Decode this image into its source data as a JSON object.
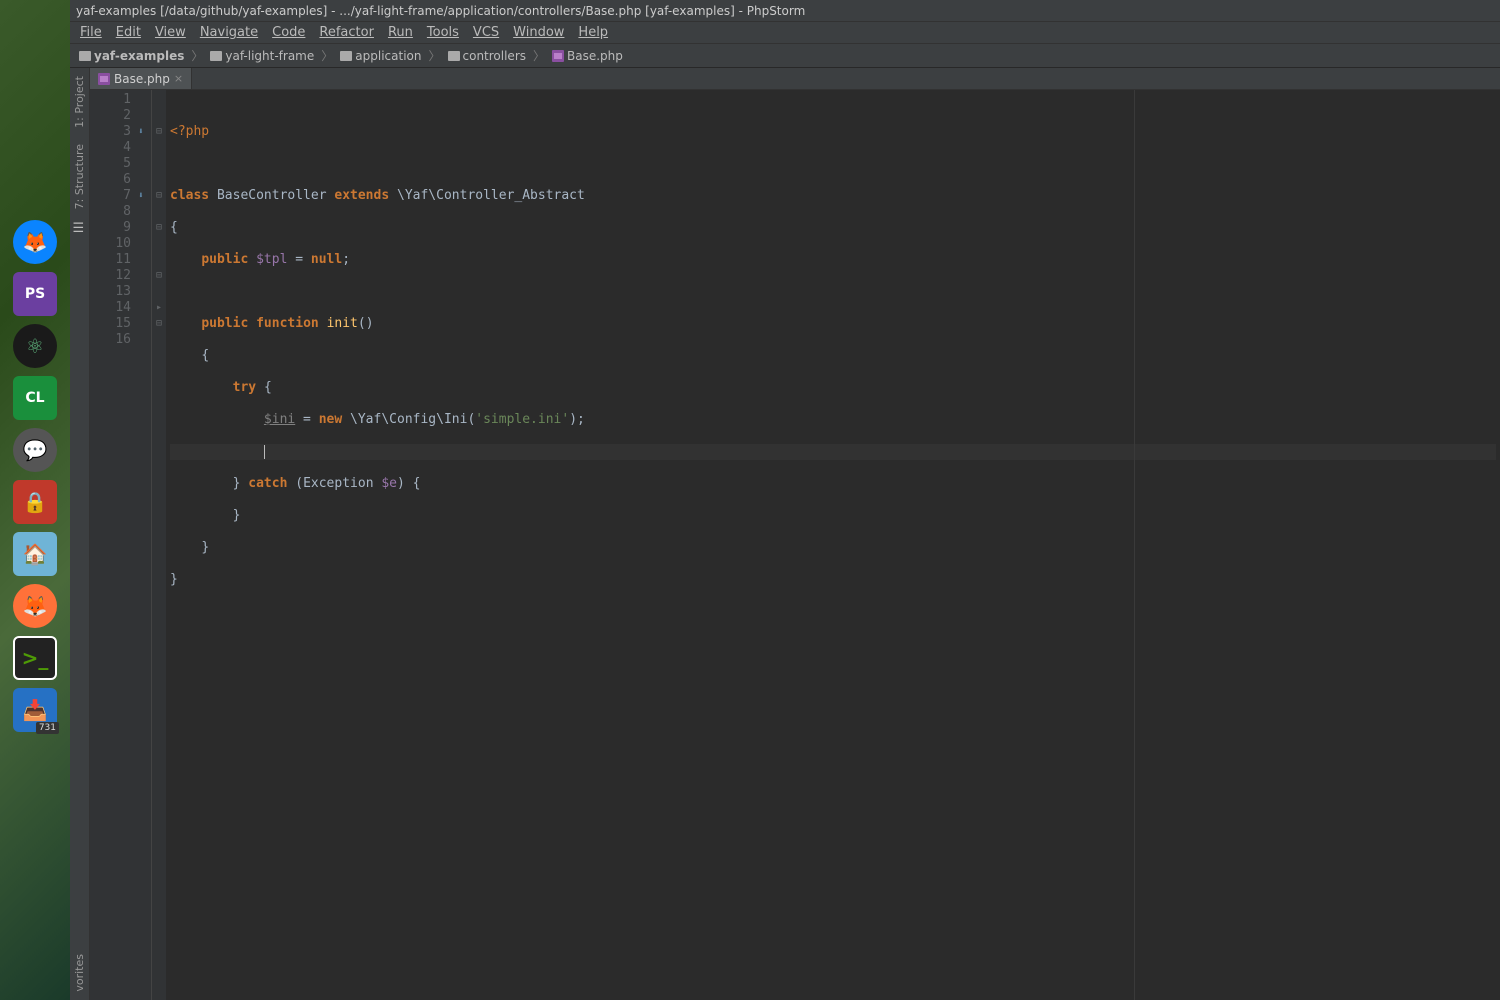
{
  "titlebar": "yaf-examples [/data/github/yaf-examples] - .../yaf-light-frame/application/controllers/Base.php [yaf-examples] - PhpStorm",
  "menu": {
    "file": "File",
    "edit": "Edit",
    "view": "View",
    "navigate": "Navigate",
    "code": "Code",
    "refactor": "Refactor",
    "run": "Run",
    "tools": "Tools",
    "vcs": "VCS",
    "window": "Window",
    "help": "Help"
  },
  "breadcrumbs": {
    "b0": "yaf-examples",
    "b1": "yaf-light-frame",
    "b2": "application",
    "b3": "controllers",
    "b4": "Base.php"
  },
  "tabs": {
    "t0": "Base.php"
  },
  "toolwindows": {
    "project": "1: Project",
    "structure": "7: Structure",
    "favorites": "vorites"
  },
  "lines": {
    "l1": "1",
    "l2": "2",
    "l3": "3",
    "l4": "4",
    "l5": "5",
    "l6": "6",
    "l7": "7",
    "l8": "8",
    "l9": "9",
    "l10": "10",
    "l11": "11",
    "l12": "12",
    "l13": "13",
    "l14": "14",
    "l15": "15",
    "l16": "16"
  },
  "code": {
    "phpopen": "<?php",
    "class_kw": "class",
    "class_name": "BaseController",
    "extends_kw": "extends",
    "parent": "\\Yaf\\Controller_Abstract",
    "brace_o": "{",
    "pub_kw": "public",
    "var_tpl": "$tpl",
    "eq": " = ",
    "null_kw": "null",
    "semi": ";",
    "func_kw": "function",
    "init_name": "init",
    "paren": "()",
    "try_kw": "try",
    "var_ini": "$ini",
    "new_kw": "new",
    "cfg_class": "\\Yaf\\Config\\Ini",
    "call_o": "(",
    "str_simple": "'simple.ini'",
    "call_c": ")",
    "catch_kw": "catch",
    "exc": "Exception",
    "var_e": "$e",
    "brace_c": "}"
  },
  "dock": {
    "phpstorm": "PS",
    "clion": "CL",
    "terminal": ">_",
    "badge": "731"
  }
}
